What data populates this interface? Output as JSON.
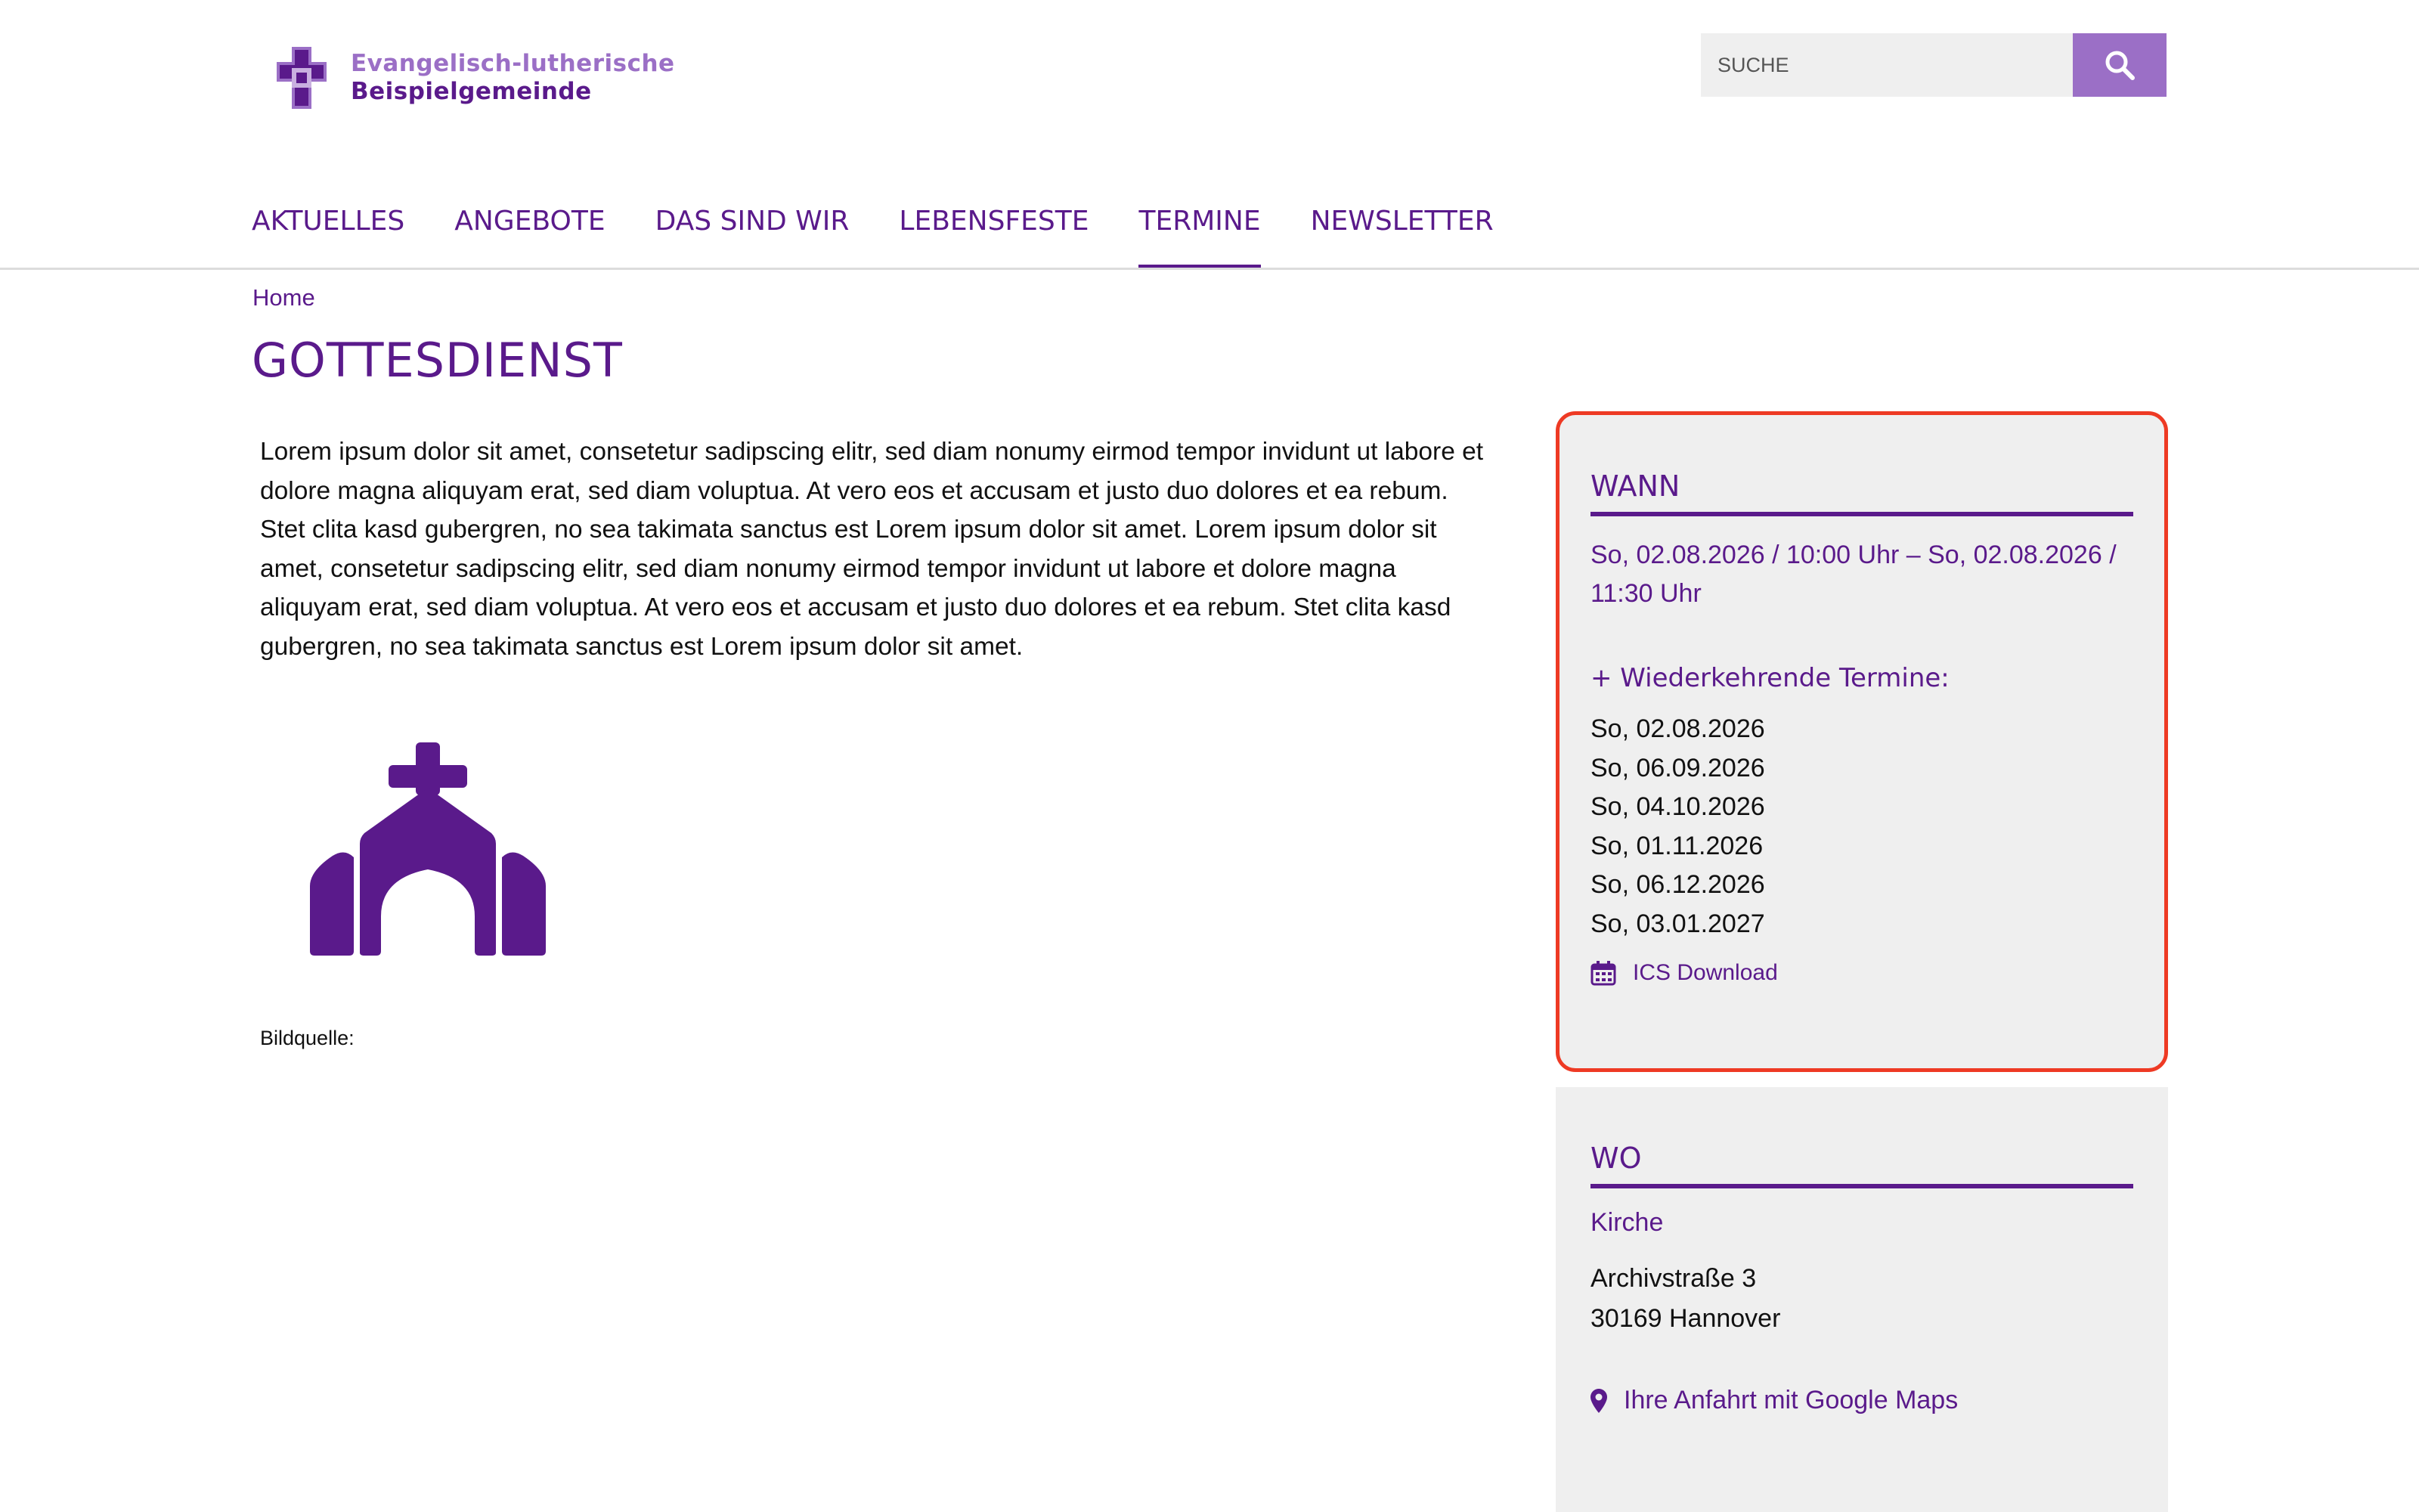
{
  "colors": {
    "brand": "#5a1a8b",
    "brand_light": "#9b6fc6",
    "highlight_border": "#ee3a24",
    "box_bg": "#efefef"
  },
  "header": {
    "logo_line1": "Evangelisch-lutherische",
    "logo_line2": "Beispielgemeinde",
    "search_placeholder": "SUCHE",
    "search_icon": "magnifier-icon"
  },
  "nav": {
    "items": [
      {
        "label": "AKTUELLES"
      },
      {
        "label": "ANGEBOTE"
      },
      {
        "label": "DAS SIND WIR"
      },
      {
        "label": "LEBENSFESTE"
      },
      {
        "label": "TERMINE",
        "active": true
      },
      {
        "label": "NEWSLETTER"
      }
    ]
  },
  "breadcrumb": "Home",
  "page_title": "GOTTESDIENST",
  "body_text": "Lorem ipsum dolor sit amet, consetetur sadipscing elitr, sed diam nonumy eirmod tempor invidunt ut labore et dolore magna aliquyam erat, sed diam voluptua. At vero eos et accusam et justo duo dolores et ea rebum. Stet clita kasd gubergren, no sea takimata sanctus est Lorem ipsum dolor sit amet. Lorem ipsum dolor sit amet, consetetur sadipscing elitr, sed diam nonumy eirmod tempor invidunt ut labore et dolore magna aliquyam erat, sed diam voluptua. At vero eos et accusam et justo duo dolores et ea rebum. Stet clita kasd gubergren, no sea takimata sanctus est Lorem ipsum dolor sit amet.",
  "image_icon": "church-icon",
  "caption": "Bildquelle:",
  "wann": {
    "heading": "WANN",
    "range": "So, 02.08.2026 / 10:00 Uhr – So, 02.08.2026 / 11:30 Uhr",
    "recurring_title": "+ Wiederkehrende Termine:",
    "dates": [
      "So, 02.08.2026",
      "So, 06.09.2026",
      "So, 04.10.2026",
      "So, 01.11.2026",
      "So, 06.12.2026",
      "So, 03.01.2027"
    ],
    "ics_icon": "calendar-icon",
    "ics_label": "ICS Download"
  },
  "wo": {
    "heading": "WO",
    "place": "Kirche",
    "street": "Archivstraße 3",
    "city": "30169 Hannover",
    "maps_icon": "map-pin-icon",
    "maps_label": "Ihre Anfahrt mit Google Maps"
  }
}
